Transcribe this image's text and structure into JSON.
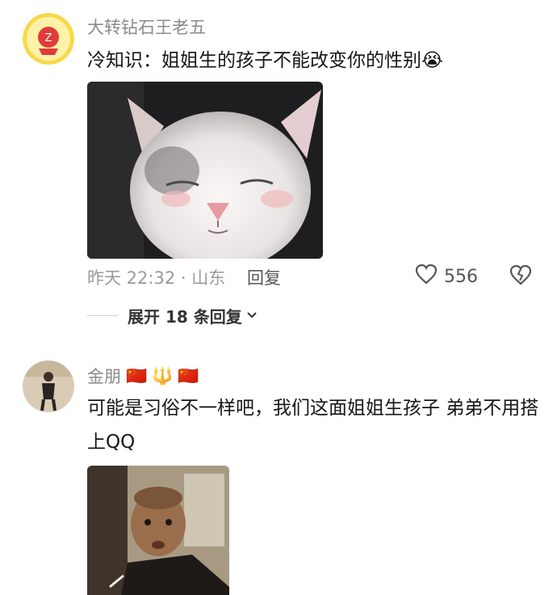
{
  "comments": [
    {
      "username": "大转钻石王老五",
      "text": "冷知识：姐姐生的孩子不能改变你的性别",
      "emoji": "😭",
      "meta": "昨天 22:32 · 山东",
      "reply_label": "回复",
      "like_count": "556",
      "expand_label": "展开 18 条回复",
      "media_desc": "cat-meme"
    },
    {
      "username": "金朋",
      "badges": [
        "🇨🇳",
        "🔱",
        "🇨🇳"
      ],
      "text": "可能是习俗不一样吧，我们这面姐姐生孩子 弟弟不用搭上QQ",
      "media_desc": "man-meme"
    }
  ],
  "colors": {
    "username": "#8a8a8a",
    "meta": "#9a9a9a",
    "text": "#161616"
  }
}
